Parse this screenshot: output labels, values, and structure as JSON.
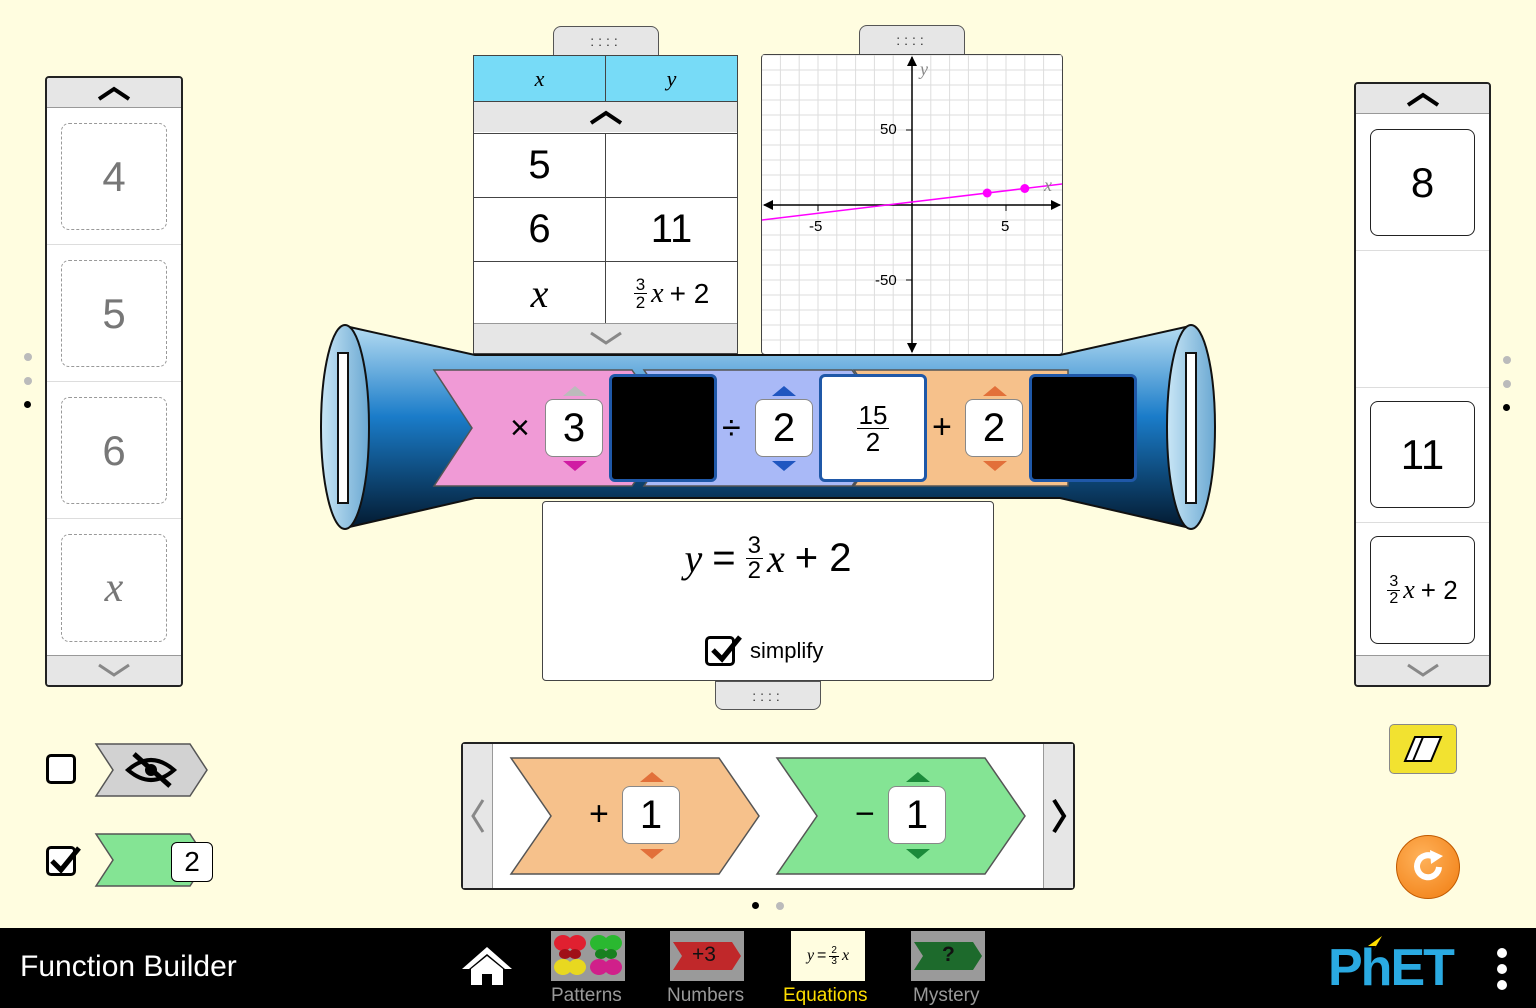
{
  "app": {
    "title": "Function Builder"
  },
  "input_carousel": {
    "items": [
      "4",
      "5",
      "6",
      "x"
    ],
    "page_dots": 3,
    "active_dot": 2
  },
  "output_carousel": {
    "items": [
      "8",
      "",
      "11",
      "3/2 x + 2"
    ],
    "page_dots": 3,
    "active_dot": 2
  },
  "table": {
    "headers": {
      "x": "x",
      "y": "y"
    },
    "rows": [
      {
        "x": "5",
        "y": ""
      },
      {
        "x": "6",
        "y": "11"
      },
      {
        "x": "x",
        "y_num": "3",
        "y_den": "2",
        "y_var": "x",
        "y_rest": "+ 2"
      }
    ]
  },
  "graph": {
    "x_axis_label": "x",
    "y_axis_label": "y",
    "x_ticks": [
      "-5",
      "5"
    ],
    "y_ticks": [
      "50",
      "-50"
    ],
    "points": [
      [
        4,
        8
      ],
      [
        6,
        11
      ]
    ],
    "line_color": "#ff00ff"
  },
  "builder": {
    "functions": [
      {
        "op": "×",
        "value": "3",
        "color": "#f09ad6"
      },
      {
        "op": "÷",
        "value": "2",
        "color": "#a9b9f7"
      },
      {
        "op": "+",
        "value": "2",
        "color": "#f6c18b"
      }
    ],
    "windows": [
      {
        "content": ""
      },
      {
        "num": "15",
        "den": "2"
      },
      {
        "content": ""
      }
    ]
  },
  "equation": {
    "y": "y",
    "eq": "=",
    "num": "3",
    "den": "2",
    "var": "x",
    "rest": "+ 2",
    "simplify_label": "simplify",
    "simplify_checked": true
  },
  "toolbox": {
    "functions": [
      {
        "op": "+",
        "value": "1",
        "color": "#f6c18b"
      },
      {
        "op": "−",
        "value": "1",
        "color": "#84e494"
      }
    ],
    "page_dots": 2,
    "active_dot": 0
  },
  "controls": {
    "hide_functions_checked": false,
    "mystery_count_checked": true,
    "mystery_count": "2"
  },
  "nav": {
    "tabs": [
      {
        "label": "Patterns",
        "active": false
      },
      {
        "label": "Numbers",
        "icon_text": "+3",
        "active": false
      },
      {
        "label": "Equations",
        "icon_text": "y = 2/3 x",
        "active": true
      },
      {
        "label": "Mystery",
        "icon_text": "?",
        "active": false
      }
    ],
    "brand": "PhET",
    "active_color": "#ffde00"
  }
}
